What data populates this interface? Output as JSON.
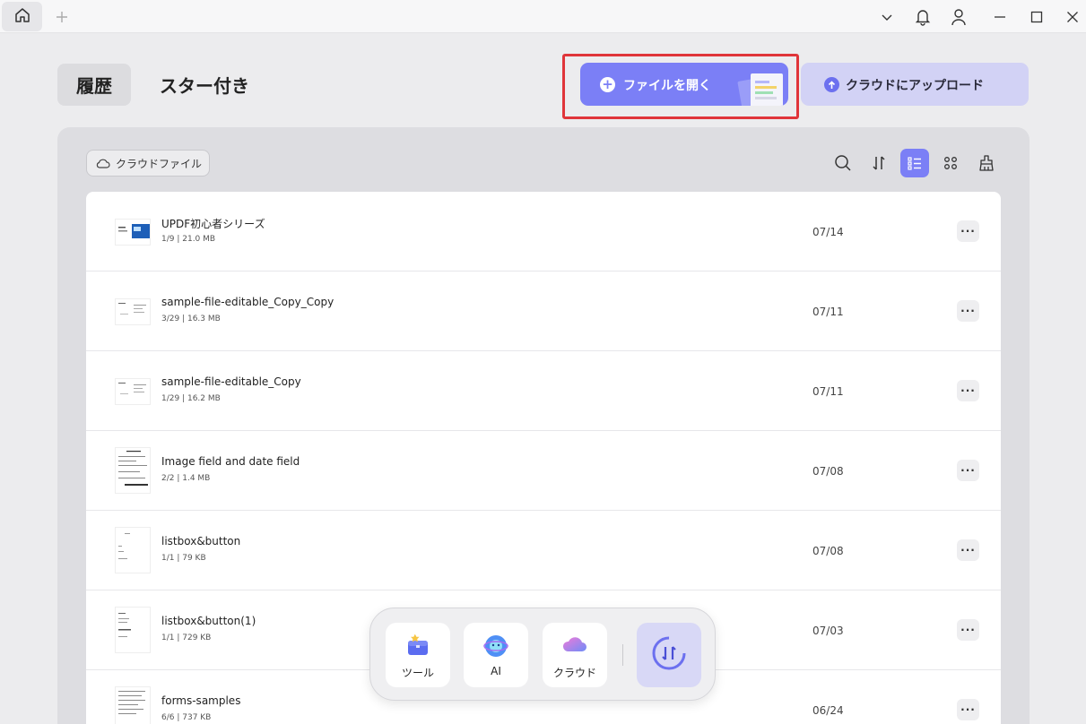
{
  "titlebar": {
    "home_icon": "home-icon",
    "new_tab_icon": "plus-icon",
    "dropdown_icon": "chevron-down-icon",
    "bell_icon": "bell-icon",
    "user_icon": "user-icon",
    "minimize_icon": "minimize-icon",
    "maximize_icon": "maximize-icon",
    "close_icon": "close-icon"
  },
  "header": {
    "tab_history": "履歴",
    "tab_starred": "スター付き",
    "open_file_label": "ファイルを開く",
    "upload_label": "クラウドにアップロード"
  },
  "toolbar": {
    "cloud_files_label": "クラウドファイル",
    "icons": [
      "search-icon",
      "sort-icon",
      "list-view-icon",
      "grid-view-icon",
      "clear-icon"
    ]
  },
  "files": [
    {
      "name": "UPDF初心者シリーズ",
      "meta": "1/9 | 21.0 MB",
      "date": "07/14"
    },
    {
      "name": "sample-file-editable_Copy_Copy",
      "meta": "3/29 | 16.3 MB",
      "date": "07/11"
    },
    {
      "name": "sample-file-editable_Copy",
      "meta": "1/29 | 16.2 MB",
      "date": "07/11"
    },
    {
      "name": "Image field and date field",
      "meta": "2/2 | 1.4 MB",
      "date": "07/08"
    },
    {
      "name": "listbox&button",
      "meta": "1/1 | 79 KB",
      "date": "07/08"
    },
    {
      "name": "listbox&button(1)",
      "meta": "1/1 | 729 KB",
      "date": "07/03"
    },
    {
      "name": "forms-samples",
      "meta": "6/6 | 737 KB",
      "date": "06/24"
    }
  ],
  "more_label": "···",
  "dock": {
    "tools_label": "ツール",
    "ai_label": "AI",
    "cloud_label": "クラウド"
  },
  "colors": {
    "accent": "#7b7ff6",
    "highlight_border": "#e0353a"
  }
}
